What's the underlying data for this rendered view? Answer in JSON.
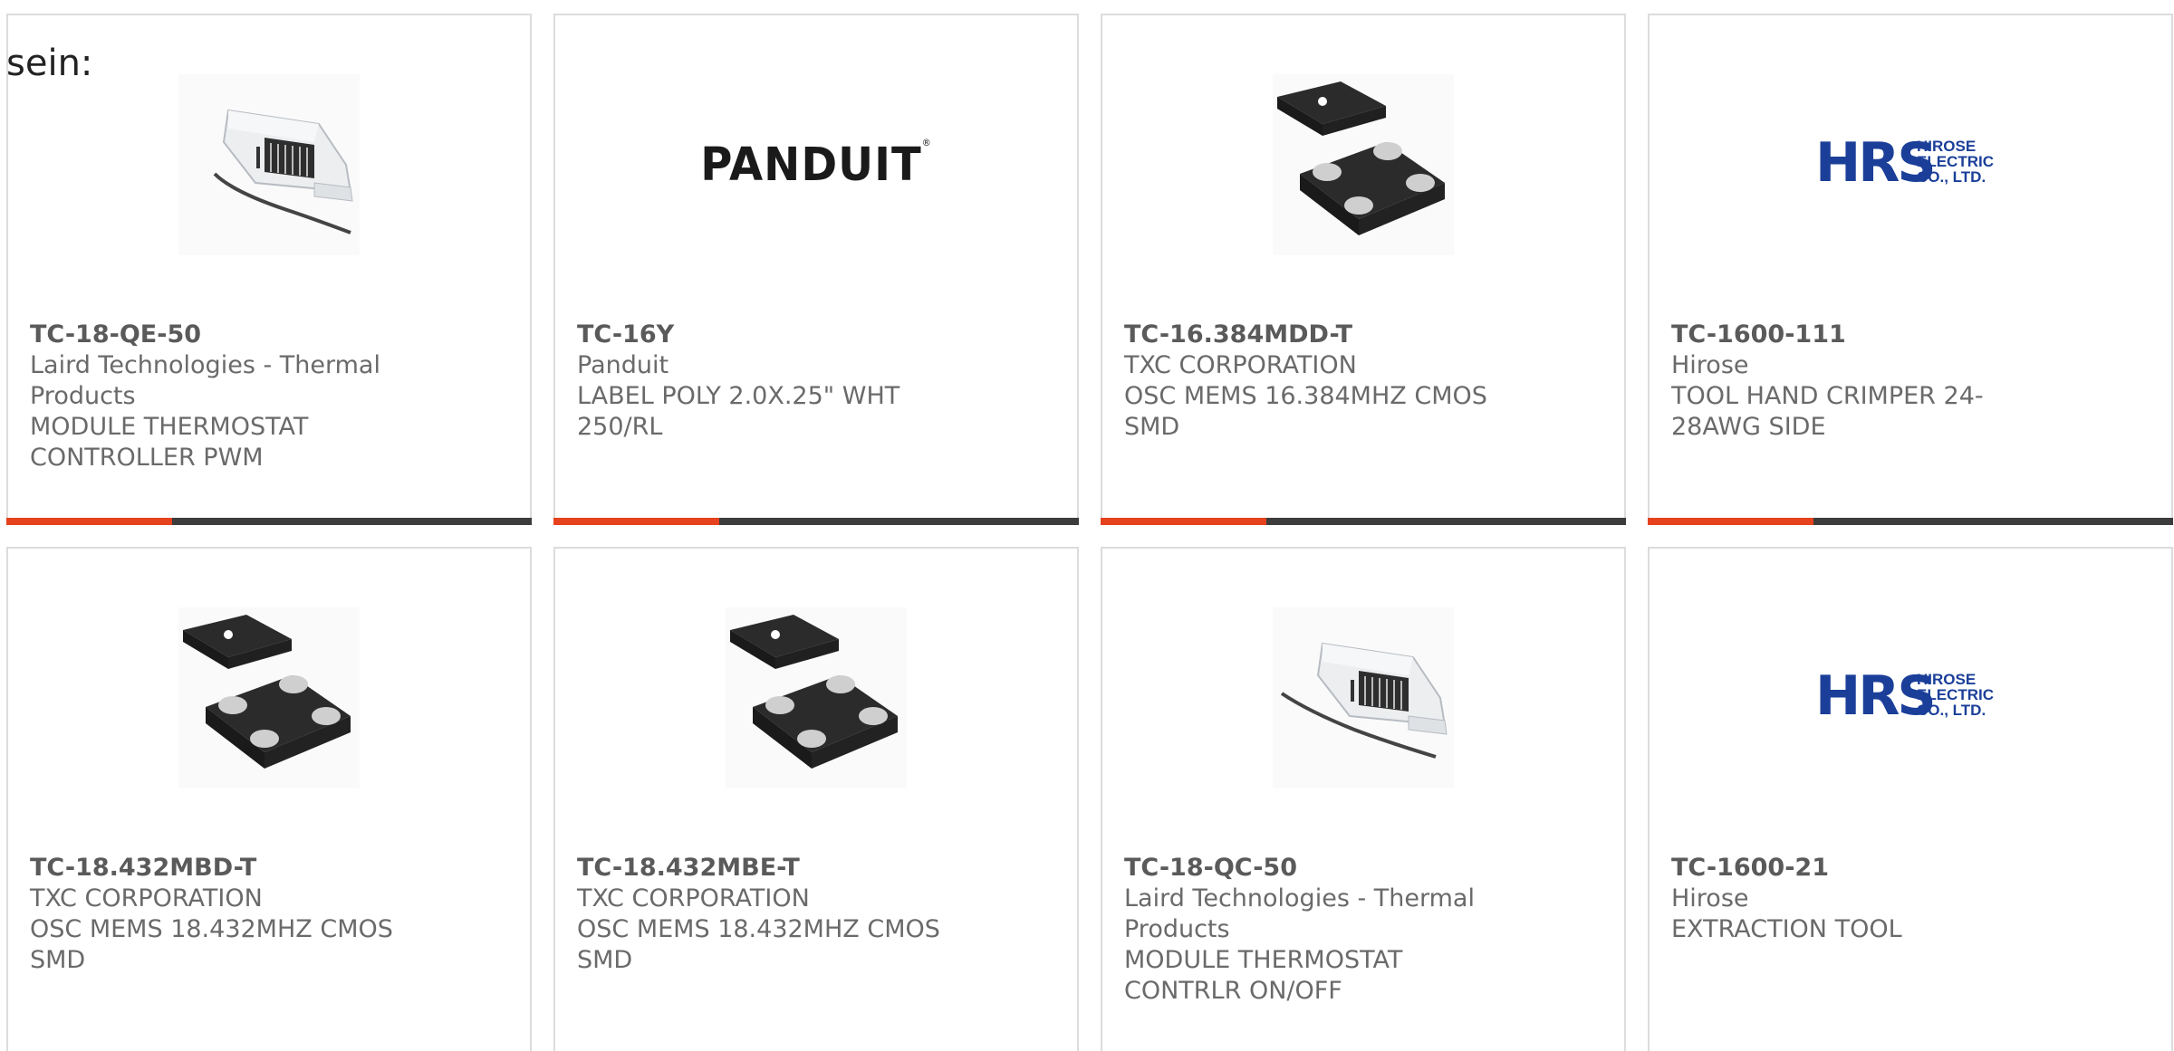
{
  "intro_text": "sein:",
  "colors": {
    "accent": "#e6421d",
    "bar": "#3c3c3c",
    "card_border": "#dcdcdc",
    "text": "#6a6a6a",
    "hirose_blue": "#1b3f99"
  },
  "products": [
    {
      "image": "thermostat-module-image",
      "part_number": "TC-18-QE-50",
      "manufacturer": "Laird Technologies - Thermal Products",
      "description": "MODULE THERMOSTAT CONTROLLER PWM"
    },
    {
      "image": "panduit-logo",
      "logo_text": "PANDUIT",
      "part_number": "TC-16Y",
      "manufacturer": "Panduit",
      "description": "LABEL POLY 2.0X.25\" WHT 250/RL"
    },
    {
      "image": "mems-oscillator-image",
      "part_number": "TC-16.384MDD-T",
      "manufacturer": "TXC CORPORATION",
      "description": "OSC MEMS 16.384MHZ CMOS SMD"
    },
    {
      "image": "hirose-logo",
      "logo_text": "HRS",
      "logo_subtext": [
        "HIROSE",
        "ELECTRIC",
        "CO., LTD."
      ],
      "part_number": "TC-1600-111",
      "manufacturer": "Hirose",
      "description": "TOOL HAND CRIMPER 24-28AWG SIDE"
    },
    {
      "image": "mems-oscillator-image",
      "part_number": "TC-18.432MBD-T",
      "manufacturer": "TXC CORPORATION",
      "description": "OSC MEMS 18.432MHZ CMOS SMD"
    },
    {
      "image": "mems-oscillator-image",
      "part_number": "TC-18.432MBE-T",
      "manufacturer": "TXC CORPORATION",
      "description": "OSC MEMS 18.432MHZ CMOS SMD"
    },
    {
      "image": "thermostat-module-image",
      "part_number": "TC-18-QC-50",
      "manufacturer": "Laird Technologies - Thermal Products",
      "description": "MODULE THERMOSTAT CONTRLR ON/OFF"
    },
    {
      "image": "hirose-logo",
      "logo_text": "HRS",
      "logo_subtext": [
        "HIROSE",
        "ELECTRIC",
        "CO., LTD."
      ],
      "part_number": "TC-1600-21",
      "manufacturer": "Hirose",
      "description": "EXTRACTION TOOL"
    }
  ]
}
